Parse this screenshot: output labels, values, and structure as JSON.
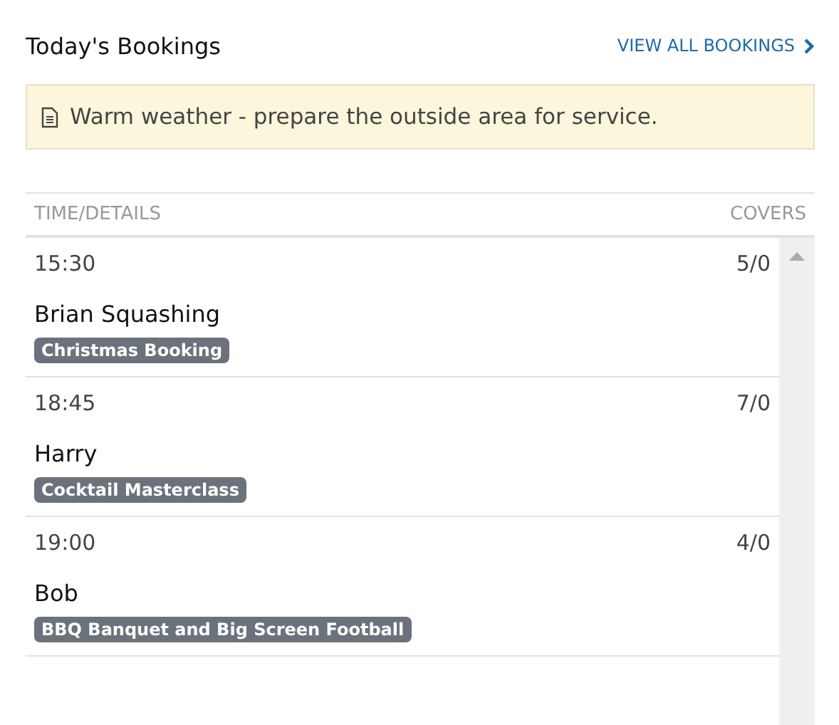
{
  "header": {
    "title": "Today's Bookings",
    "link": "VIEW ALL BOOKINGS"
  },
  "notice": {
    "text": "Warm weather - prepare the outside area for service."
  },
  "table": {
    "columns": [
      "TIME/DETAILS",
      "COVERS"
    ],
    "rows": [
      {
        "time": "15:30",
        "covers": "5/0",
        "name": "Brian Squashing",
        "tag": "Christmas Booking"
      },
      {
        "time": "18:45",
        "covers": "7/0",
        "name": "Harry",
        "tag": "Cocktail Masterclass"
      },
      {
        "time": "19:00",
        "covers": "4/0",
        "name": "Bob",
        "tag": "BBQ Banquet and Big Screen Football"
      }
    ]
  }
}
